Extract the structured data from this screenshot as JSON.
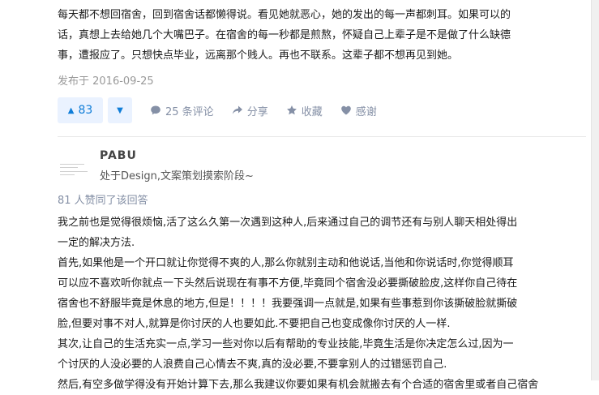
{
  "first_answer": {
    "lines": [
      "每天都不想回宿舍，回到宿舍话都懒得说。看见她就恶心，她的发出的每一声都刺耳。如果可以的",
      "话，真想上去给她几个大嘴巴子。在宿舍的每一秒都是煎熬，怀疑自己上辈子是不是做了什么缺德",
      "事，遭报应了。只想快点毕业，远离那个贱人。再也不联系。这辈子都不想再见到她。"
    ],
    "published": "发布于 2016-09-25"
  },
  "actions": {
    "vote_count": "83",
    "comments": "25 条评论",
    "share": "分享",
    "collect": "收藏",
    "thanks": "感谢",
    "colors": {
      "accent": "#0f7dd8",
      "accent_bg": "#eaf2ff",
      "muted": "#8590a6"
    }
  },
  "author": {
    "name": "PABU",
    "bio": "处于Design,文案策划摸索阶段~"
  },
  "agree_text": "81 人赞同了该回答",
  "second_answer": {
    "lines": [
      "我之前也是觉得很烦恼,活了这么久第一次遇到这种人,后来通过自己的调节还有与别人聊天相处得出",
      "一定的解决方法.",
      "首先,如果他是一个开口就让你觉得不爽的人,那么你就别主动和他说话,当他和你说话时,你觉得顺耳",
      "可以应不喜欢听你就点一下头然后说现在有事不方便,毕竟同个宿舍没必要撕破脸皮,这样你自己待在",
      "宿舍也不舒服毕竟是休息的地方,但是！！！！我要强调一点就是,如果有些事惹到你该撕破脸就撕破",
      "脸,但要对事不对人,就算是你讨厌的人也要如此.不要把自己也变成像你讨厌的人一样.",
      "其次,让自己的生活充实一点,学习一些对你以后有帮助的专业技能,毕竟生活是你决定怎么过,因为一",
      "个讨厌的人没必要的人浪费自己心情去不爽,真的没必要,不要拿别人的过错惩罚自己.",
      "然后,有空多做学得没有开始计算下去,那么我建议你要如果有机会就搬去有个合适的宿舍里或者自己宿舍"
    ]
  }
}
